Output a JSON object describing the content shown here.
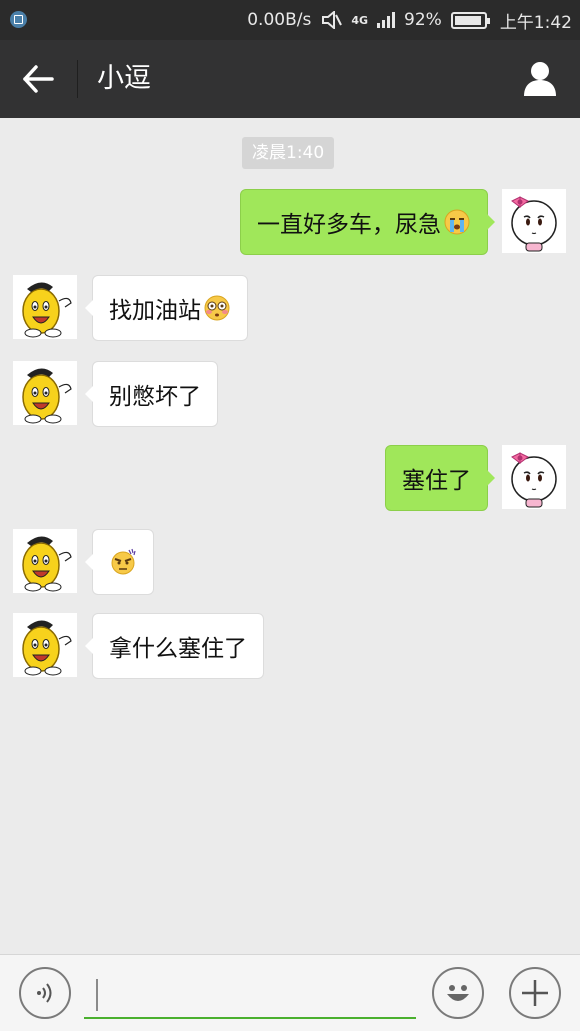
{
  "status_bar": {
    "speed": "0.00B/s",
    "network": "4G",
    "battery": "92%",
    "battery_level": 0.92,
    "time": "上午1:42"
  },
  "nav": {
    "title": "小逗",
    "back_icon": "back-arrow-icon",
    "profile_icon": "person-icon"
  },
  "chat": {
    "timestamp": "凌晨1:40",
    "messages": [
      {
        "side": "out",
        "text": "一直好多车，尿急",
        "emoji": "crying-face-emoji",
        "avatar": "girl-avatar"
      },
      {
        "side": "in",
        "text": "找加油站",
        "emoji": "flushed-face-emoji",
        "avatar": "yellow-mascot-avatar"
      },
      {
        "side": "in",
        "text": "别憋坏了",
        "emoji": "",
        "avatar": "yellow-mascot-avatar"
      },
      {
        "side": "out",
        "text": "塞住了",
        "emoji": "",
        "avatar": "girl-avatar"
      },
      {
        "side": "in",
        "text": "",
        "emoji": "angry-face-emoji",
        "avatar": "yellow-mascot-avatar"
      },
      {
        "side": "in",
        "text": "拿什么塞住了",
        "emoji": "",
        "avatar": "yellow-mascot-avatar"
      }
    ]
  },
  "input_bar": {
    "voice_icon": "voice-icon",
    "emoji_icon": "smiley-icon",
    "add_icon": "plus-icon",
    "value": "",
    "placeholder": ""
  },
  "colors": {
    "nav_bg": "#323233",
    "chat_bg": "#ebebeb",
    "outgoing_bubble": "#a0e75a",
    "incoming_bubble": "#ffffff",
    "accent_green": "#4ab02e"
  }
}
